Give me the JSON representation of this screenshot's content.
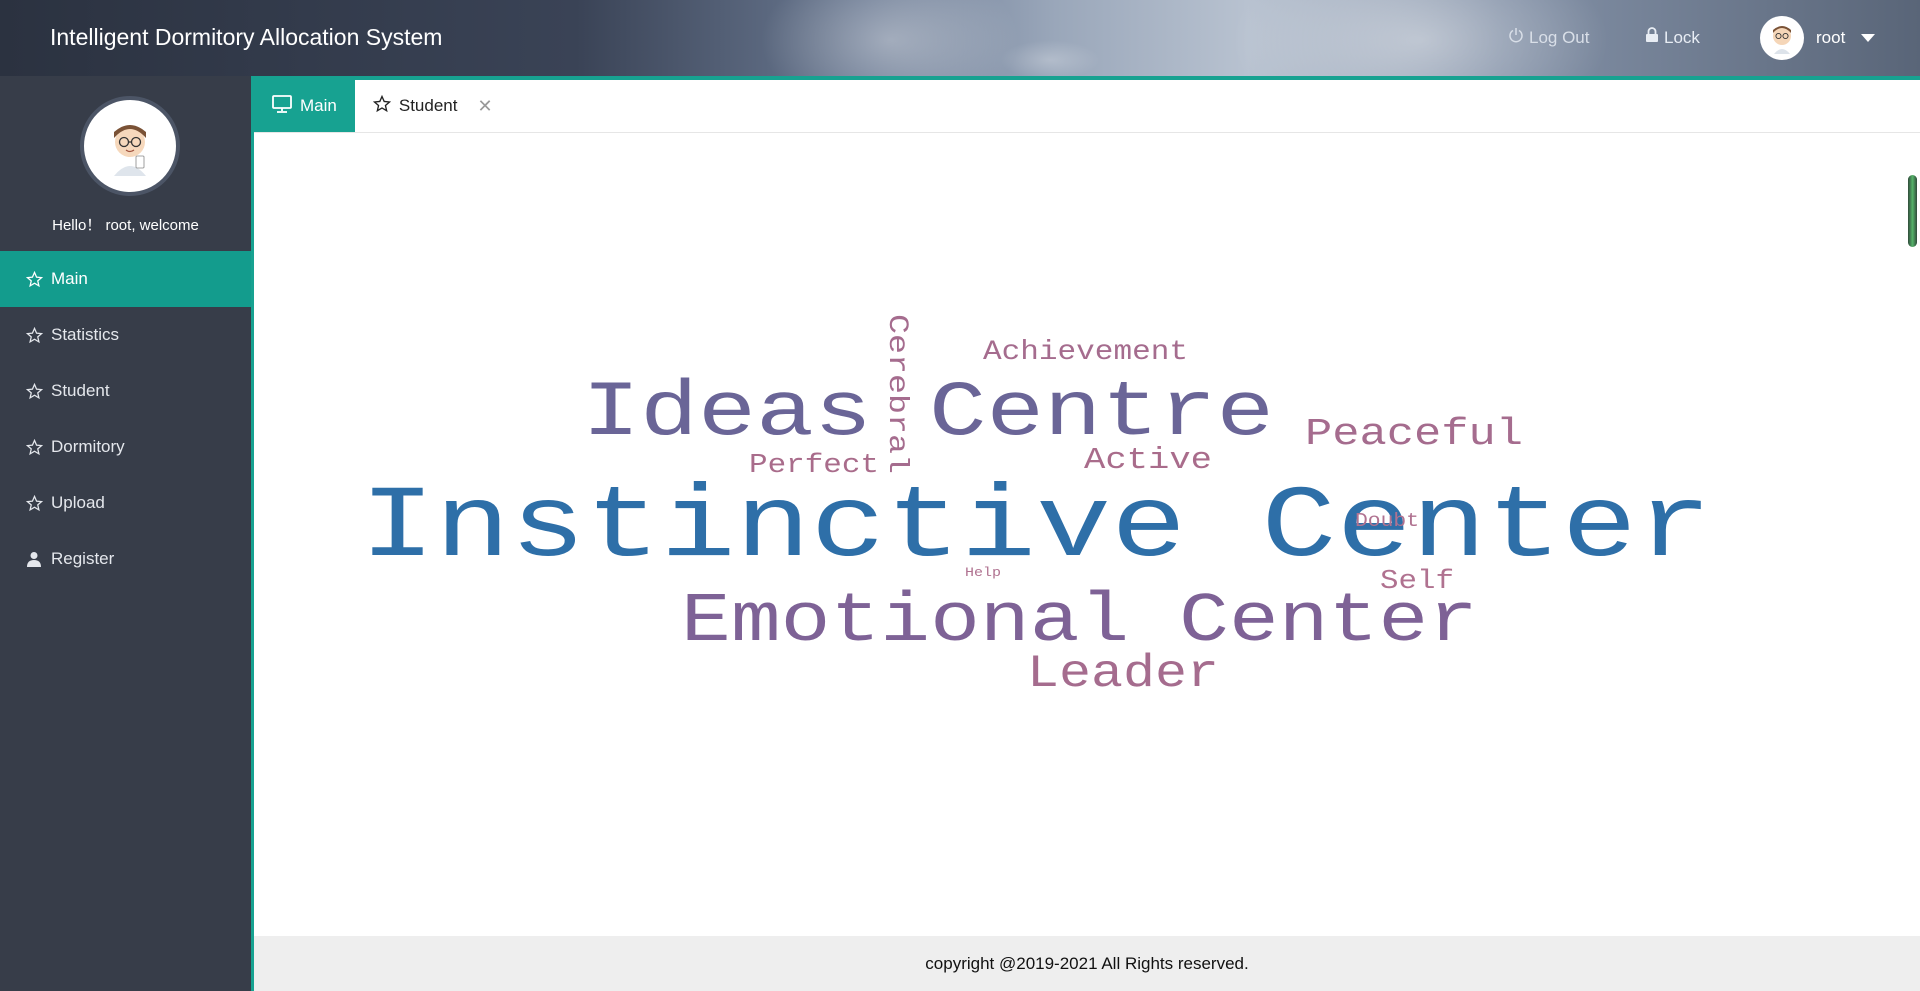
{
  "header": {
    "title": "Intelligent Dormitory Allocation System",
    "logout_label": "Log Out",
    "lock_label": "Lock",
    "user_name": "root"
  },
  "sidebar": {
    "welcome": "Hello！ root, welcome",
    "items": [
      {
        "label": "Main",
        "icon": "star-icon",
        "active": true
      },
      {
        "label": "Statistics",
        "icon": "star-icon"
      },
      {
        "label": "Student",
        "icon": "star-icon"
      },
      {
        "label": "Dormitory",
        "icon": "star-icon"
      },
      {
        "label": "Upload",
        "icon": "star-icon"
      },
      {
        "label": "Register",
        "icon": "user-icon"
      }
    ]
  },
  "tabs": [
    {
      "label": "Main",
      "icon": "monitor-icon",
      "active": true
    },
    {
      "label": "Student",
      "icon": "star-icon",
      "closable": true
    }
  ],
  "word_cloud": {
    "words": [
      {
        "text": "Instinctive Center",
        "color": "#2e6fa8",
        "weight": 10
      },
      {
        "text": "Ideas",
        "color": "#6a6597",
        "weight": 6
      },
      {
        "text": "Centre",
        "color": "#6a6597",
        "weight": 6
      },
      {
        "text": "Emotional Center",
        "color": "#7e6296",
        "weight": 6
      },
      {
        "text": "Cerebral",
        "color": "#a56c8e",
        "weight": 3,
        "vertical": true
      },
      {
        "text": "Achievement",
        "color": "#a56c8e",
        "weight": 3
      },
      {
        "text": "Peaceful",
        "color": "#a56c8e",
        "weight": 3
      },
      {
        "text": "Perfect",
        "color": "#a96c8b",
        "weight": 2
      },
      {
        "text": "Active",
        "color": "#a96c8b",
        "weight": 3
      },
      {
        "text": "Leader",
        "color": "#a56c8e",
        "weight": 4
      },
      {
        "text": "Doubt",
        "color": "#b07290",
        "weight": 1
      },
      {
        "text": "Self",
        "color": "#b07290",
        "weight": 2
      },
      {
        "text": "Help",
        "color": "#b07290",
        "weight": 1
      }
    ]
  },
  "footer": {
    "text": "copyright @2019-2021 All Rights reserved."
  },
  "colors": {
    "accent": "#17a291",
    "sidebar_bg": "#373d49"
  }
}
